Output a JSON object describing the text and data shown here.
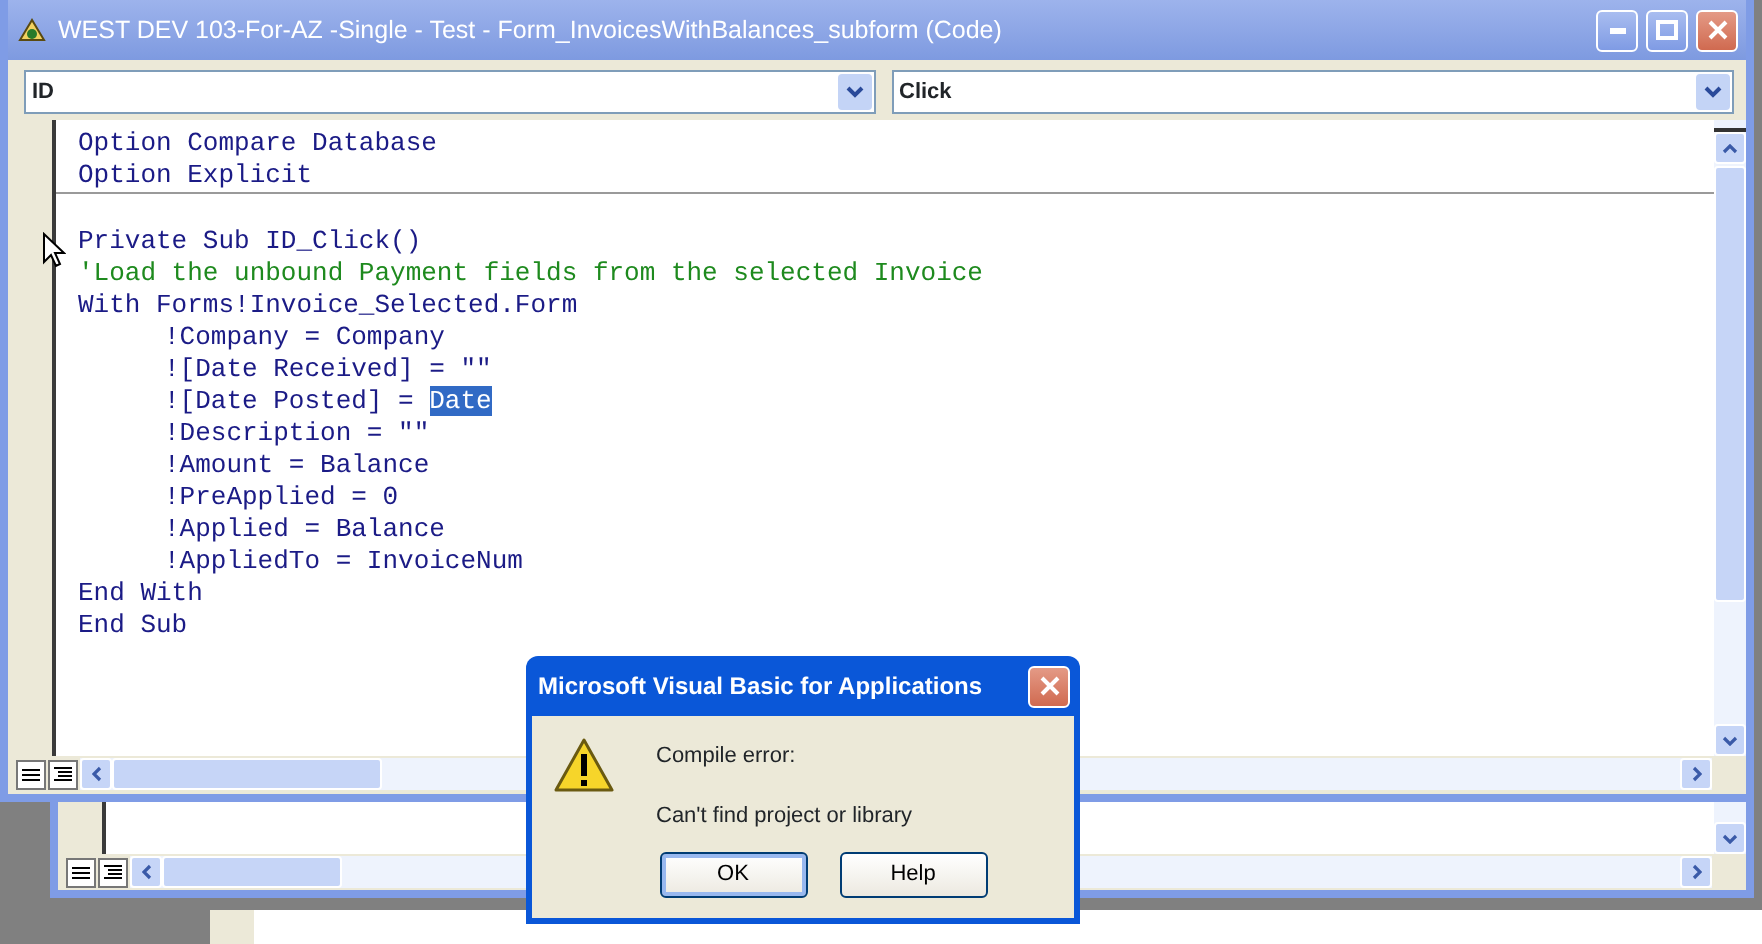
{
  "window": {
    "title": "WEST DEV 103-For-AZ -Single - Test - Form_InvoicesWithBalances_subform (Code)"
  },
  "object_dropdown": {
    "value": "ID"
  },
  "procedure_dropdown": {
    "value": "Click"
  },
  "code": {
    "sections": [
      {
        "lines": [
          {
            "kind": "code",
            "text": "Option Compare Database"
          },
          {
            "kind": "code",
            "text": "Option Explicit"
          }
        ]
      },
      {
        "lines": [
          {
            "kind": "blank"
          },
          {
            "kind": "code",
            "text": "Private Sub ID_Click()"
          },
          {
            "kind": "comment",
            "text": "'Load the unbound Payment fields from the selected Invoice"
          },
          {
            "kind": "code",
            "text": "With Forms!Invoice_Selected.Form",
            "children": [
              {
                "kind": "code",
                "text": "!Company = Company"
              },
              {
                "kind": "code",
                "text": "![Date Received] = \"\""
              },
              {
                "kind": "code",
                "parts": [
                  {
                    "text": "![Date Posted] = ",
                    "selected": false
                  },
                  {
                    "text": "Date",
                    "selected": true
                  }
                ]
              },
              {
                "kind": "code",
                "text": "!Description = \"\""
              },
              {
                "kind": "code",
                "text": "!Amount = Balance"
              },
              {
                "kind": "code",
                "text": "!PreApplied = 0"
              },
              {
                "kind": "code",
                "text": "!Applied = Balance"
              },
              {
                "kind": "code",
                "text": "!AppliedTo = InvoiceNum"
              }
            ]
          },
          {
            "kind": "code",
            "text": "End With"
          },
          {
            "kind": "code",
            "text": "End Sub"
          }
        ]
      }
    ]
  },
  "dialog": {
    "title": "Microsoft Visual Basic for Applications",
    "heading": "Compile error:",
    "message": "Can't find project or library",
    "buttons": [
      {
        "label": "OK",
        "default": true
      },
      {
        "label": "Help",
        "default": false
      }
    ]
  }
}
